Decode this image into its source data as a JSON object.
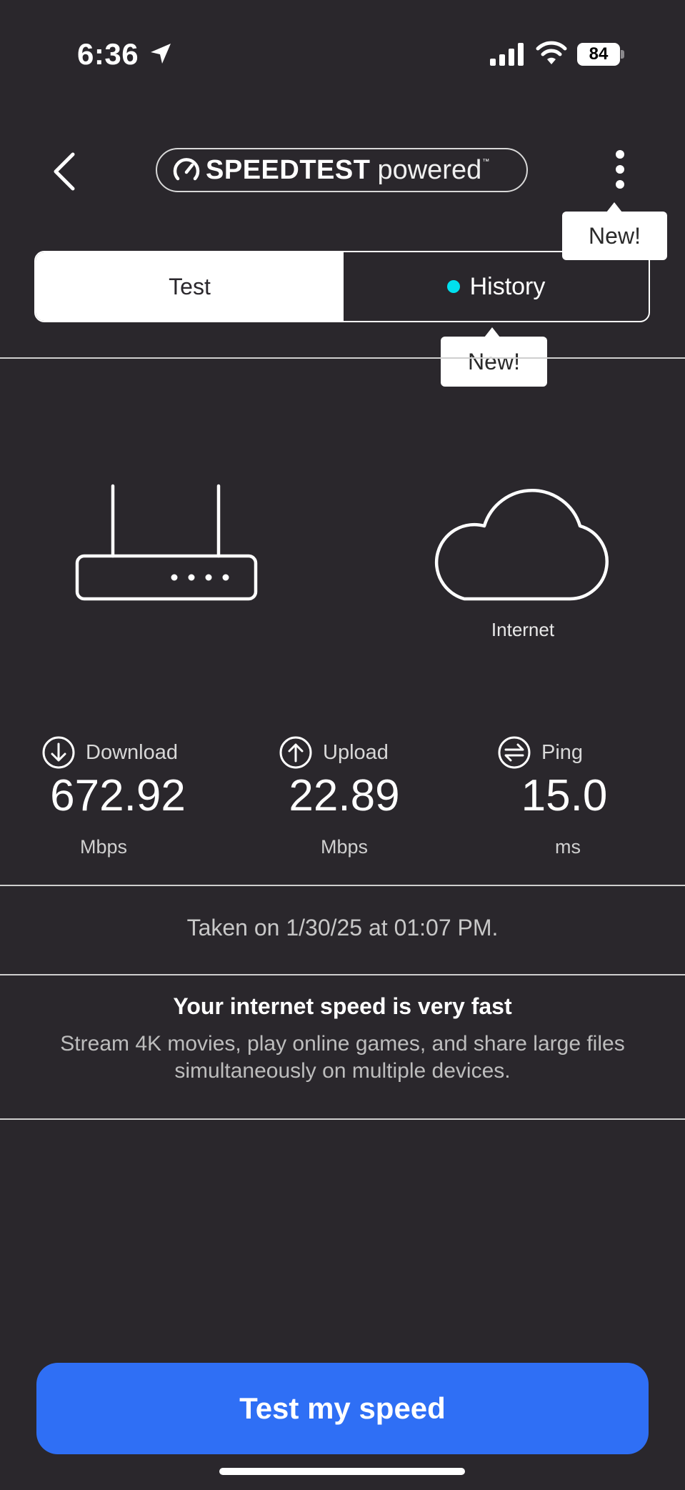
{
  "status_bar": {
    "time": "6:36",
    "battery": "84",
    "icons": [
      "location-arrow-icon",
      "signal-icon",
      "wifi-icon",
      "battery-icon"
    ]
  },
  "header": {
    "logo_brand": "SPEEDTEST",
    "logo_powered": "powered",
    "logo_tm": "™",
    "menu_tooltip": "New!"
  },
  "tabs": {
    "test_label": "Test",
    "history_label": "History",
    "history_tooltip": "New!",
    "active": "Test"
  },
  "diagram": {
    "internet_label": "Internet",
    "icons": [
      "router-icon",
      "cloud-icon"
    ]
  },
  "metrics": {
    "download": {
      "label": "Download",
      "value": "672.92",
      "unit": "Mbps"
    },
    "upload": {
      "label": "Upload",
      "value": "22.89",
      "unit": "Mbps"
    },
    "ping": {
      "label": "Ping",
      "value": "15.0",
      "unit": "ms"
    }
  },
  "result": {
    "taken": "Taken on 1/30/25 at 01:07 PM.",
    "verdict_title": "Your internet speed is very fast",
    "verdict_desc": "Stream 4K movies, play online games, and share large files simultaneously on multiple devices."
  },
  "actions": {
    "test_button": "Test my speed"
  },
  "colors": {
    "background": "#2a272c",
    "accent_button": "#2f6ff5",
    "history_dot": "#00e0ee"
  }
}
